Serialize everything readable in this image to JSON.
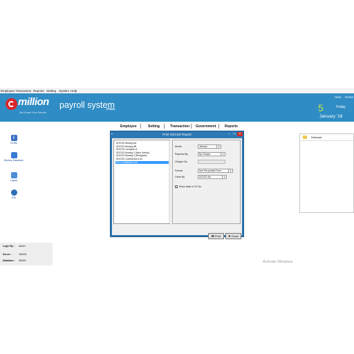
{
  "menu": [
    "Employee",
    "Transaction",
    "Reports",
    "Setting",
    "System",
    "Help"
  ],
  "header": {
    "logo": "million",
    "tagline": "We Know Your Needs",
    "app_title": "payroll system",
    "edition": "(PNMX)",
    "links": [
      "Here",
      "Home"
    ],
    "day": "5",
    "weekday": "Friday",
    "month_year": "January '18"
  },
  "tabs": [
    "Employee",
    "Setting",
    "Transaction",
    "Government",
    "Reports"
  ],
  "nav": [
    {
      "label": "Profile",
      "icon": "info-icon",
      "color": "#3b6fc4"
    },
    {
      "label": "Backup Database",
      "icon": "database-icon",
      "color": "#3a7bd5"
    },
    {
      "label": "Logout",
      "icon": "logout-icon",
      "color": "#4b8fd6"
    },
    {
      "label": "Exit",
      "icon": "exit-icon",
      "color": "#2f6fb8"
    }
  ],
  "info": {
    "login_label": "Login By :",
    "login_value": "admin",
    "server_label": "Server :",
    "server_value": "1M\\001",
    "database_label": "Database :",
    "database_value": "DEMO"
  },
  "notepad": {
    "title": "Notepad"
  },
  "dialog": {
    "title": "Print SOCSO Report",
    "reports": [
      "SOCSO Borang 8A",
      "SOCSO Borang 8B",
      "SOCSO Lampiran A",
      "SOCSO Borang 2 (New Joined)",
      "SOCSO Borang 3 (Resigned)",
      "SOCSO Contribution List",
      "EIS Contribution List"
    ],
    "selected_index": 6,
    "month_label": "Month",
    "month_value": "January",
    "payment_label": "Payment By",
    "payment_value": "By Cheque",
    "cheque_label": "Cheque No.",
    "cheque_value": "",
    "format_label": "Format",
    "format_value": "Non Pre-printed Form",
    "order_label": "Order By",
    "order_value": "SOCSO No.",
    "show_dash_label": "Show dash in I/C No.",
    "show_dash_checked": true,
    "print_label": "Print",
    "close_label": "Close"
  },
  "watermark": "Activate Windows"
}
